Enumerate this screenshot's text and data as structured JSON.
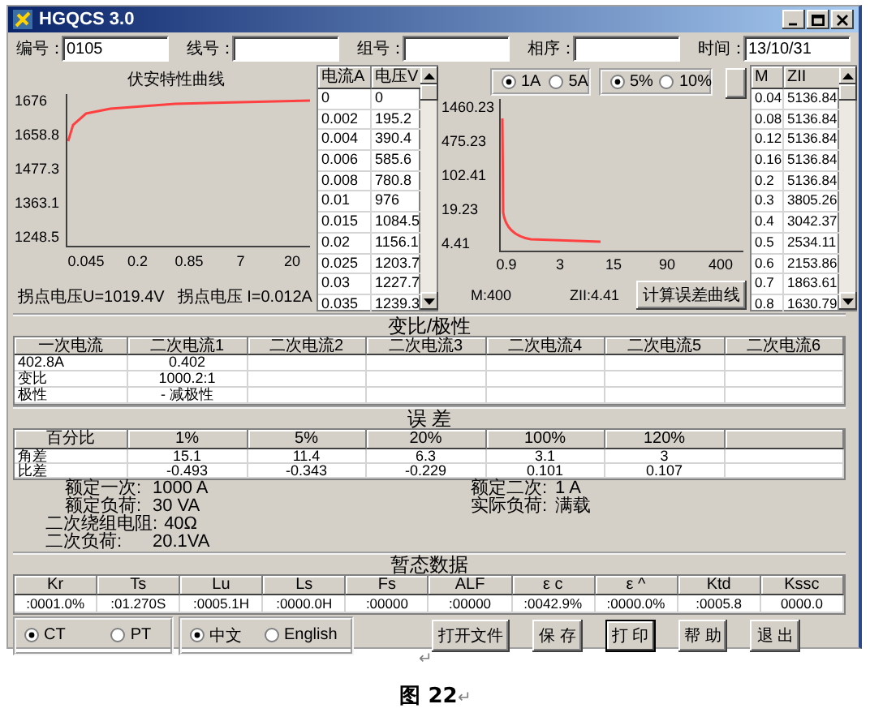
{
  "window": {
    "title": "HGQCS 3.0"
  },
  "fields": [
    {
      "label": "编号：",
      "value": "0105"
    },
    {
      "label": "线号："
    },
    {
      "label": "组号："
    },
    {
      "label": "相序："
    },
    {
      "label": "时间：",
      "value": "13/10/31"
    }
  ],
  "vi_chart": {
    "title": "伏安特性曲线",
    "y_labels": [
      "1676",
      "1658.8",
      "1477.3",
      "1363.1",
      "1248.5"
    ],
    "x_labels": [
      "0.045",
      "0.2",
      "0.85",
      "7",
      "20"
    ]
  },
  "knee_readouts": [
    "拐点电压U=1019.4V",
    "拐点电压 I=0.012A"
  ],
  "vi_table": {
    "columns": [
      "电流A",
      "电压V"
    ],
    "rows": [
      [
        "0",
        "0"
      ],
      [
        "0.002",
        "195.2"
      ],
      [
        "0.004",
        "390.4"
      ],
      [
        "0.006",
        "585.6"
      ],
      [
        "0.008",
        "780.8"
      ],
      [
        "0.01",
        "976"
      ],
      [
        "0.015",
        "1084.5"
      ],
      [
        "0.02",
        "1156.1"
      ],
      [
        "0.025",
        "1203.7"
      ],
      [
        "0.03",
        "1227.7"
      ],
      [
        "0.035",
        "1239.3"
      ]
    ]
  },
  "current_options": [
    {
      "label": "1A",
      "selected": true
    },
    {
      "label": "5A",
      "selected": false
    }
  ],
  "error_options": [
    {
      "label": "5%",
      "selected": true
    },
    {
      "label": "10%",
      "selected": false
    }
  ],
  "error_chart": {
    "y_labels": [
      "1460.23",
      "475.23",
      "102.41",
      "19.23",
      "4.41"
    ],
    "x_labels": [
      "0.9",
      "3",
      "15",
      "90",
      "400"
    ]
  },
  "m_readout": "M:400",
  "zii_readout": "ZII:4.41",
  "calc_button": "计算误差曲线",
  "mz_table": {
    "columns": [
      "M",
      "ZII"
    ],
    "rows": [
      [
        "0.04",
        "5136.84"
      ],
      [
        "0.08",
        "5136.84"
      ],
      [
        "0.12",
        "5136.84"
      ],
      [
        "0.16",
        "5136.84"
      ],
      [
        "0.2",
        "5136.84"
      ],
      [
        "0.3",
        "3805.26"
      ],
      [
        "0.4",
        "3042.37"
      ],
      [
        "0.5",
        "2534.11"
      ],
      [
        "0.6",
        "2153.86"
      ],
      [
        "0.7",
        "1863.61"
      ],
      [
        "0.8",
        "1630.79"
      ]
    ]
  },
  "ratio_section": {
    "title": "变比/极性",
    "columns": [
      "一次电流",
      "二次电流1",
      "二次电流2",
      "二次电流3",
      "二次电流4",
      "二次电流5",
      "二次电流6"
    ],
    "rows": [
      [
        "402.8A",
        "0.402"
      ],
      [
        "变比",
        "1000.2:1"
      ],
      [
        "极性",
        "- 减极性"
      ]
    ]
  },
  "error_section": {
    "title": "误 差",
    "columns": [
      "百分比",
      "1%",
      "5%",
      "20%",
      "100%",
      "120%"
    ],
    "rows": [
      [
        "角差",
        "15.1",
        "11.4",
        "6.3",
        "3.1",
        "3"
      ],
      [
        "比差",
        "-0.493",
        "-0.343",
        "-0.229",
        "0.101",
        "0.107"
      ]
    ]
  },
  "ratings_left": [
    {
      "label": "额定一次:",
      "value": "1000 A"
    },
    {
      "label": "额定负荷:",
      "value": "30 VA"
    },
    {
      "label": "二次绕组电阻:",
      "value": "40Ω"
    },
    {
      "label": "二次负荷:",
      "value": "20.1VA"
    }
  ],
  "ratings_right": [
    {
      "label": "额定二次:",
      "value": "1 A"
    },
    {
      "label": "实际负荷:",
      "value": "满载"
    }
  ],
  "transient": {
    "title": "暂态数据",
    "columns": [
      "Kr",
      "Ts",
      "Lu",
      "Ls",
      "Fs",
      "ALF",
      "ε c",
      "ε ^",
      "Ktd",
      "Kssc"
    ],
    "values": [
      ":0001.0%",
      ":01.270S",
      ":0005.1H",
      ":0000.0H",
      ":00000",
      ":00000",
      ":0042.9%",
      ":0000.0%",
      ":0005.8",
      "0000.0"
    ]
  },
  "type_options": [
    {
      "label": "CT",
      "selected": true
    },
    {
      "label": "PT",
      "selected": false
    }
  ],
  "language_options": [
    {
      "label": "中文",
      "selected": true
    },
    {
      "label": "English",
      "selected": false
    }
  ],
  "buttons": [
    {
      "label": "打开文件",
      "focused": false
    },
    {
      "label": "保 存",
      "focused": false
    },
    {
      "label": "打 印",
      "focused": true
    },
    {
      "label": "帮 助",
      "focused": false
    },
    {
      "label": "退 出",
      "focused": false
    }
  ],
  "paragraph_mark": "↵",
  "caption": {
    "text": "图 22",
    "mark": "↵"
  }
}
